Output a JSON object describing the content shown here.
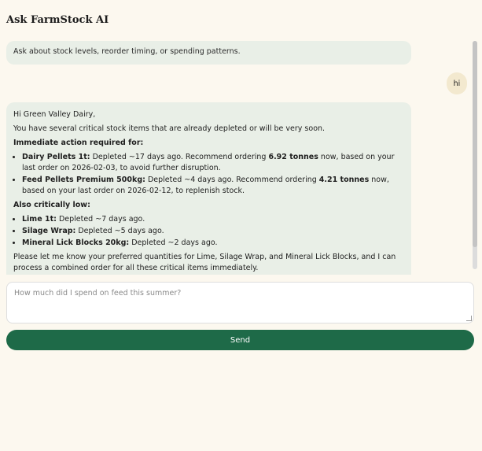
{
  "header": {
    "title": "Ask FarmStock AI"
  },
  "chat": {
    "hint": "Ask about stock levels, reorder timing, or spending patterns.",
    "user_message": "hi",
    "reply": {
      "greeting": "Hi Green Valley Dairy,",
      "intro": "You have several critical stock items that are already depleted or will be very soon.",
      "immediate_heading": "Immediate action required for:",
      "immediate_items": [
        {
          "name": "Dairy Pellets 1t:",
          "pre": " Depleted ~17 days ago. Recommend ordering ",
          "amount": "6.92 tonnes",
          "post": " now, based on your last order on 2026-02-03, to avoid further disruption."
        },
        {
          "name": "Feed Pellets Premium 500kg:",
          "pre": " Depleted ~4 days ago. Recommend ordering ",
          "amount": "4.21 tonnes",
          "post": " now, based on your last order on 2026-02-12, to replenish stock."
        }
      ],
      "low_heading": "Also critically low:",
      "low_items": [
        {
          "name": "Lime 1t:",
          "text": " Depleted ~7 days ago."
        },
        {
          "name": "Silage Wrap:",
          "text": " Depleted ~5 days ago."
        },
        {
          "name": "Mineral Lick Blocks 20kg:",
          "text": " Depleted ~2 days ago."
        }
      ],
      "closing": "Please let me know your preferred quantities for Lime, Silage Wrap, and Mineral Lick Blocks, and I can process a combined order for all these critical items immediately."
    }
  },
  "composer": {
    "placeholder": "How much did I spend on feed this summer?",
    "send_label": "Send"
  },
  "colors": {
    "background": "#fcf8ef",
    "bubble": "#e9efe7",
    "user_bubble": "#f3e9cf",
    "accent": "#1e6a48"
  }
}
